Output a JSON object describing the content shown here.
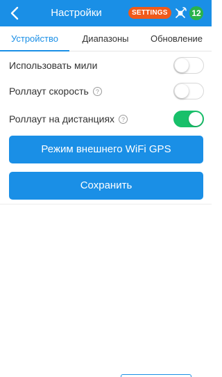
{
  "header": {
    "title": "Настройки",
    "settings_badge": "SETTINGS",
    "satellite_count": "12",
    "back_icon": "chevron-left-icon",
    "satellite_icon": "satellite-icon"
  },
  "tabs": [
    {
      "label": "Устройство",
      "active": true
    },
    {
      "label": "Диапазоны",
      "active": false
    },
    {
      "label": "Обновление",
      "active": false
    }
  ],
  "settings": [
    {
      "label": "Использовать мили",
      "help": false,
      "enabled": false
    },
    {
      "label": "Роллаут скорость",
      "help": true,
      "enabled": false
    },
    {
      "label": "Роллаут на дистанциях",
      "help": true,
      "enabled": true
    }
  ],
  "help_glyph": "?",
  "buttons": {
    "wifi_gps": "Режим внешнего WiFi GPS",
    "save": "Сохранить"
  },
  "colors": {
    "primary": "#1a8fe6",
    "badge": "#f05a1a",
    "count": "#2ab34a",
    "toggle_on": "#18c06a"
  }
}
